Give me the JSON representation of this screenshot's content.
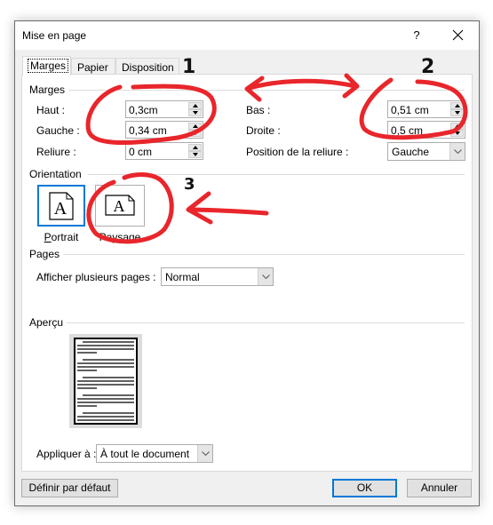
{
  "window": {
    "title": "Mise en page",
    "help_label": "?",
    "close_icon": "close-icon"
  },
  "tabs": [
    {
      "label": "Marges",
      "active": true
    },
    {
      "label": "Papier",
      "active": false
    },
    {
      "label": "Disposition",
      "active": false
    }
  ],
  "margins": {
    "group_label": "Marges",
    "haut": {
      "label": "Haut :",
      "value": "0,3cm"
    },
    "gauche": {
      "label": "Gauche :",
      "value": "0,34 cm"
    },
    "reliure": {
      "label": "Reliure :",
      "value": "0 cm"
    },
    "bas": {
      "label": "Bas :",
      "value": "0,51 cm"
    },
    "droite": {
      "label": "Droite :",
      "value": "0,5 cm"
    },
    "position_reliure": {
      "label": "Position de la reliure :",
      "value": "Gauche"
    }
  },
  "orientation": {
    "group_label": "Orientation",
    "portrait": {
      "label": "Portrait",
      "glyph": "A",
      "selected": true
    },
    "paysage": {
      "label": "Paysage",
      "glyph": "A",
      "selected": false
    }
  },
  "pages": {
    "group_label": "Pages",
    "multiple_pages": {
      "label": "Afficher plusieurs pages :",
      "value": "Normal"
    }
  },
  "preview": {
    "group_label": "Aperçu"
  },
  "apply_to": {
    "label": "Appliquer à :",
    "value": "À tout le document"
  },
  "buttons": {
    "set_default": "Définir par défaut",
    "ok": "OK",
    "cancel": "Annuler"
  },
  "annotations": {
    "numbers": [
      "1",
      "2",
      "3"
    ],
    "color": "#e8262b"
  },
  "colors": {
    "accent": "#0078d7",
    "dialog_bg": "#f0f0f0",
    "pane_bg": "#ffffff"
  }
}
